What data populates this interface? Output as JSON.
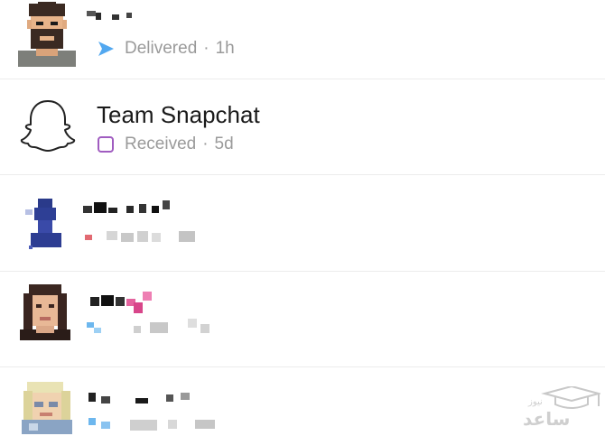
{
  "chats": [
    {
      "name": "",
      "status": "Delivered",
      "time": "1h",
      "status_icon": "sent-arrow-icon",
      "status_color": "#52a8f0",
      "name_obscured": true
    },
    {
      "name": "Team Snapchat",
      "status": "Received",
      "time": "5d",
      "status_icon": "received-chat-square-icon",
      "status_color": "#a05cc0",
      "name_obscured": false
    },
    {
      "name": "",
      "name_obscured": true
    },
    {
      "name": "",
      "name_obscured": true
    },
    {
      "name": "",
      "name_obscured": true
    }
  ],
  "separator": "·",
  "colors": {
    "delivered_blue": "#52a8f0",
    "received_purple": "#a05cc0",
    "status_grey": "#9a9a9a",
    "divider": "#ececec"
  },
  "watermark": {
    "brand_text": "ساعد",
    "sub_text": "نیوز"
  }
}
